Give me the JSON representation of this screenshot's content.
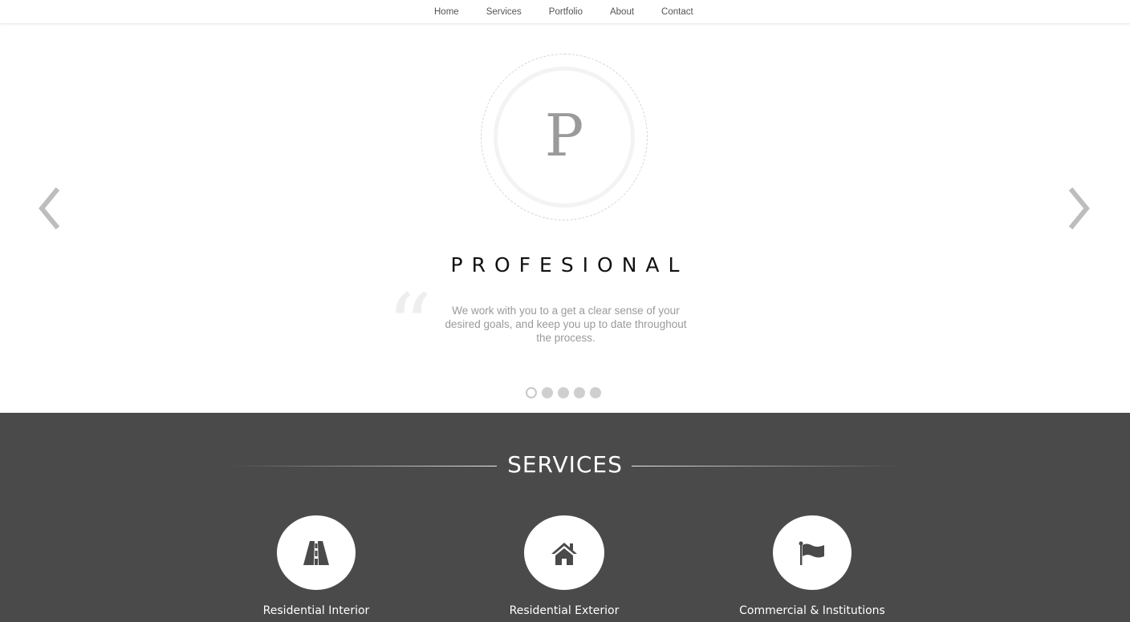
{
  "nav": {
    "items": [
      {
        "label": "Home"
      },
      {
        "label": "Services"
      },
      {
        "label": "Portfolio"
      },
      {
        "label": "About"
      },
      {
        "label": "Contact"
      }
    ]
  },
  "slider": {
    "logo_letter": "P",
    "title": "PROFESIONAL",
    "quote_mark": "“",
    "quote": "We work with you to a get a clear sense of your desired goals, and keep you up to date throughout the process.",
    "prev_icon": "chevron-left-icon",
    "next_icon": "chevron-right-icon",
    "slide_count": 5,
    "active_slide": 1
  },
  "services": {
    "heading": "SERVICES",
    "items": [
      {
        "label": "Residential Interior",
        "icon": "road-icon"
      },
      {
        "label": "Residential Exterior",
        "icon": "home-icon"
      },
      {
        "label": "Commercial & Institutions",
        "icon": "flag-icon"
      }
    ]
  },
  "colors": {
    "services_background": "#4a4a4a",
    "icon_color": "#4a4a4a",
    "arrow_color": "#bdbdbd"
  }
}
